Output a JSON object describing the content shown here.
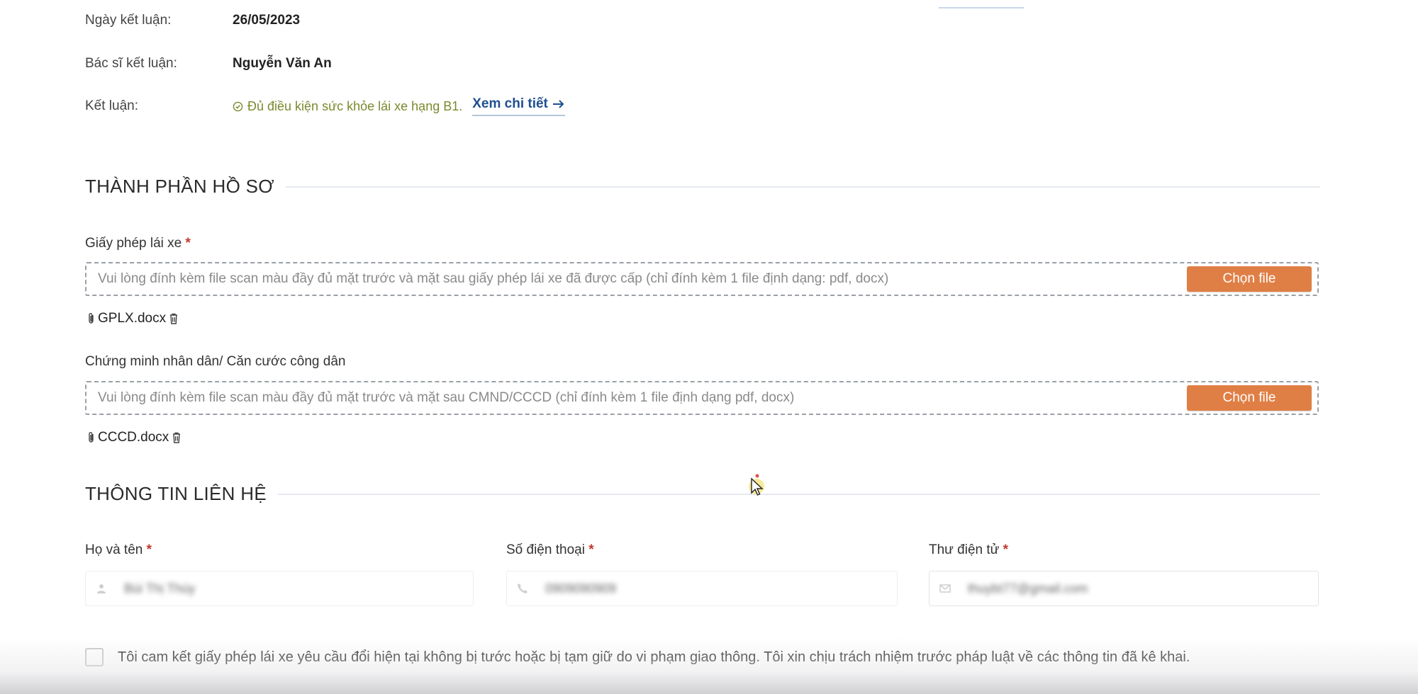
{
  "summary": {
    "date_label": "Ngày kết luận:",
    "date_value": "26/05/2023",
    "doctor_label": "Bác sĩ kết luận:",
    "doctor_value": "Nguyễn Văn An",
    "conclusion_label": "Kết luận:",
    "conclusion_value": "Đủ điều kiện sức khỏe lái xe hạng B1.",
    "detail_link": "Xem chi tiết"
  },
  "documents": {
    "section_title": "THÀNH PHẦN HỒ SƠ",
    "license": {
      "label": "Giấy phép lái xe",
      "required_mark": "*",
      "placeholder": "Vui lòng đính kèm file scan màu đầy đủ mặt trước và mặt sau giấy phép lái xe đã được cấp (chỉ đính kèm 1 file định dạng: pdf, docx)",
      "button_label": "Chọn file",
      "attached_file": "GPLX.docx"
    },
    "id_card": {
      "label": "Chứng minh nhân dân/ Căn cước công dân",
      "placeholder": "Vui lòng đính kèm file scan màu đầy đủ mặt trước và mặt sau CMND/CCCD (chỉ đính kèm 1 file định dạng pdf, docx)",
      "button_label": "Chọn file",
      "attached_file": "CCCD.docx"
    }
  },
  "contact": {
    "section_title": "THÔNG TIN LIÊN HỆ",
    "full_name_label": "Họ và tên",
    "phone_label": "Số điện thoại",
    "email_label": "Thư điện tử",
    "required_mark": "*",
    "full_name_value": "Bùi Thị Thúy",
    "phone_value": "0909090909",
    "email_value": "thuybt77@gmail.com"
  },
  "commitment": {
    "text": "Tôi cam kết giấy phép lái xe yêu cầu đổi hiện tại không bị tước hoặc bị tạm giữ do vi phạm giao thông. Tôi xin chịu trách nhiệm trước pháp luật về các thông tin đã kê khai.",
    "checked": false
  },
  "colors": {
    "accent_button": "#e07f45",
    "link": "#1f4f8f",
    "success_text": "#7a8a2e",
    "required": "#c0392b"
  }
}
